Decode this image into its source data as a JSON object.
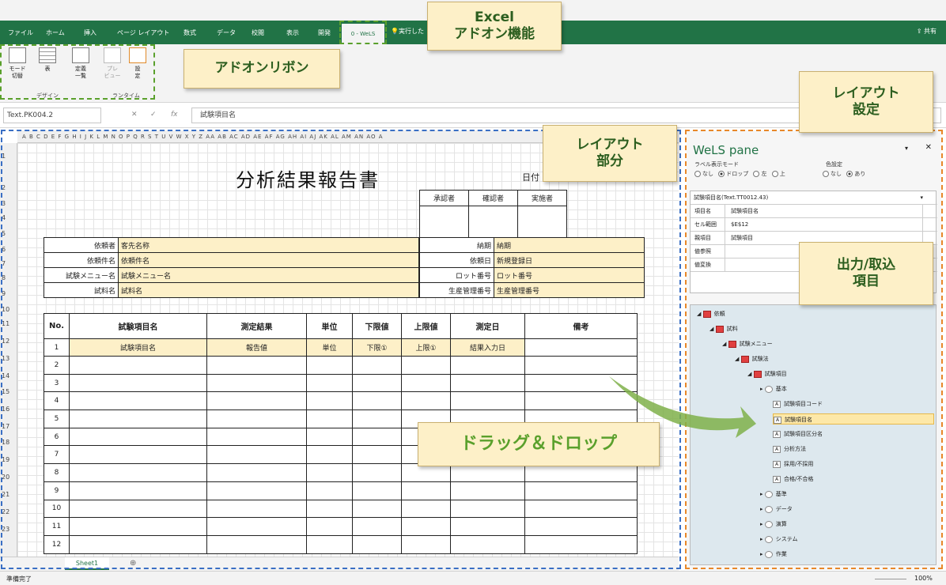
{
  "tabs": [
    "ファイル",
    "ホーム",
    "挿入",
    "ページ レイアウト",
    "数式",
    "データ",
    "校閲",
    "表示",
    "開発"
  ],
  "active_tab": "0 - WeLS",
  "tell_me": "実行した",
  "share": "共有",
  "ribbon_buttons": [
    {
      "label": "モード\n切替"
    },
    {
      "label": "表"
    },
    {
      "label": "定義\n一覧"
    },
    {
      "label": "プレ\nビュー"
    },
    {
      "label": "設\n定"
    }
  ],
  "ribbon_groups": {
    "design": "デザイン",
    "runtime": "ランタイム"
  },
  "name_box": "Text.PK004.2",
  "formula": "試験項目名",
  "col_headers": "A B C D E F G H I J K L M N O P Q R S T U V W X Y Z AA AB AC AD AE AF AG AH AI AJ AK AL AM AN AO A",
  "row_numbers": [
    "1",
    "2",
    "3",
    "4",
    "5",
    "6",
    "7",
    "8",
    "9",
    "10",
    "11",
    "12",
    "13",
    "14",
    "15",
    "16",
    "17",
    "18",
    "19",
    "20",
    "21",
    "22",
    "23"
  ],
  "report": {
    "title": "分析結果報告書",
    "date_label": "日付",
    "approvals": [
      "承認者",
      "確認者",
      "実施者"
    ],
    "info_left": [
      [
        "依頼者",
        "客先名称"
      ],
      [
        "依頼件名",
        "依頼件名"
      ],
      [
        "試験メニュー名",
        "試験メニュー名"
      ],
      [
        "試料名",
        "試料名"
      ]
    ],
    "info_right": [
      [
        "納期",
        "納期"
      ],
      [
        "依頼日",
        "新規登録日"
      ],
      [
        "ロット番号",
        "ロット番号"
      ],
      [
        "生産管理番号",
        "生産管理番号"
      ]
    ],
    "headers": [
      "No.",
      "試験項目名",
      "測定結果",
      "単位",
      "下限値",
      "上限値",
      "測定日",
      "備考"
    ],
    "first_row": [
      "1",
      "試験項目名",
      "報告値",
      "単位",
      "下限①",
      "上限①",
      "結果入力日",
      ""
    ],
    "numbers": [
      "2",
      "3",
      "4",
      "5",
      "6",
      "7",
      "8",
      "9",
      "10",
      "11",
      "12"
    ]
  },
  "sheet_tab": "Sheet1",
  "status": "準備完了",
  "zoom": "100%",
  "pane": {
    "title": "WeLS pane",
    "label_mode": "ラベル表示モード",
    "label_opts": [
      "なし",
      "ドロップ",
      "左",
      "上"
    ],
    "color_mode": "色設定",
    "color_opts": [
      "なし",
      "あり"
    ],
    "selector": "試験項目名(Text.TT0012.43)",
    "props": [
      [
        "項目名",
        "試験項目名"
      ],
      [
        "セル範囲",
        "$E$12"
      ],
      [
        "親項目",
        "試験項目"
      ],
      [
        "値参照",
        ""
      ],
      [
        "値変換",
        ""
      ]
    ],
    "tree": [
      {
        "label": "依頼",
        "indent": 0
      },
      {
        "label": "試料",
        "indent": 1
      },
      {
        "label": "試験メニュー",
        "indent": 2
      },
      {
        "label": "試験法",
        "indent": 3
      },
      {
        "label": "試験項目",
        "indent": 4
      },
      {
        "label": "基本",
        "indent": 5
      },
      {
        "label": "試験項目コード",
        "indent": 6
      },
      {
        "label": "試験項目名",
        "indent": 6,
        "selected": true
      },
      {
        "label": "試験項目区分名",
        "indent": 6
      },
      {
        "label": "分析方法",
        "indent": 6
      },
      {
        "label": "採用/不採用",
        "indent": 6
      },
      {
        "label": "合格/不合格",
        "indent": 6
      },
      {
        "label": "基準",
        "indent": 5
      },
      {
        "label": "データ",
        "indent": 5
      },
      {
        "label": "演算",
        "indent": 5
      },
      {
        "label": "システム",
        "indent": 5
      },
      {
        "label": "作業",
        "indent": 5
      }
    ]
  },
  "callouts": {
    "excel_addon": "Excel\nアドオン機能",
    "addon_ribbon": "アドオンリボン",
    "layout_part": "レイアウト\n部分",
    "layout_setting": "レイアウト\n設定",
    "io_items": "出力/取込\n項目",
    "drag_drop": "ドラッグ＆ドロップ"
  },
  "colors": {
    "excel_green": "#217346",
    "callout_bg": "#fdf0c8",
    "dash_green": "#5aa02c",
    "dash_blue": "#3a6fc4",
    "dash_orange": "#e8882a"
  }
}
